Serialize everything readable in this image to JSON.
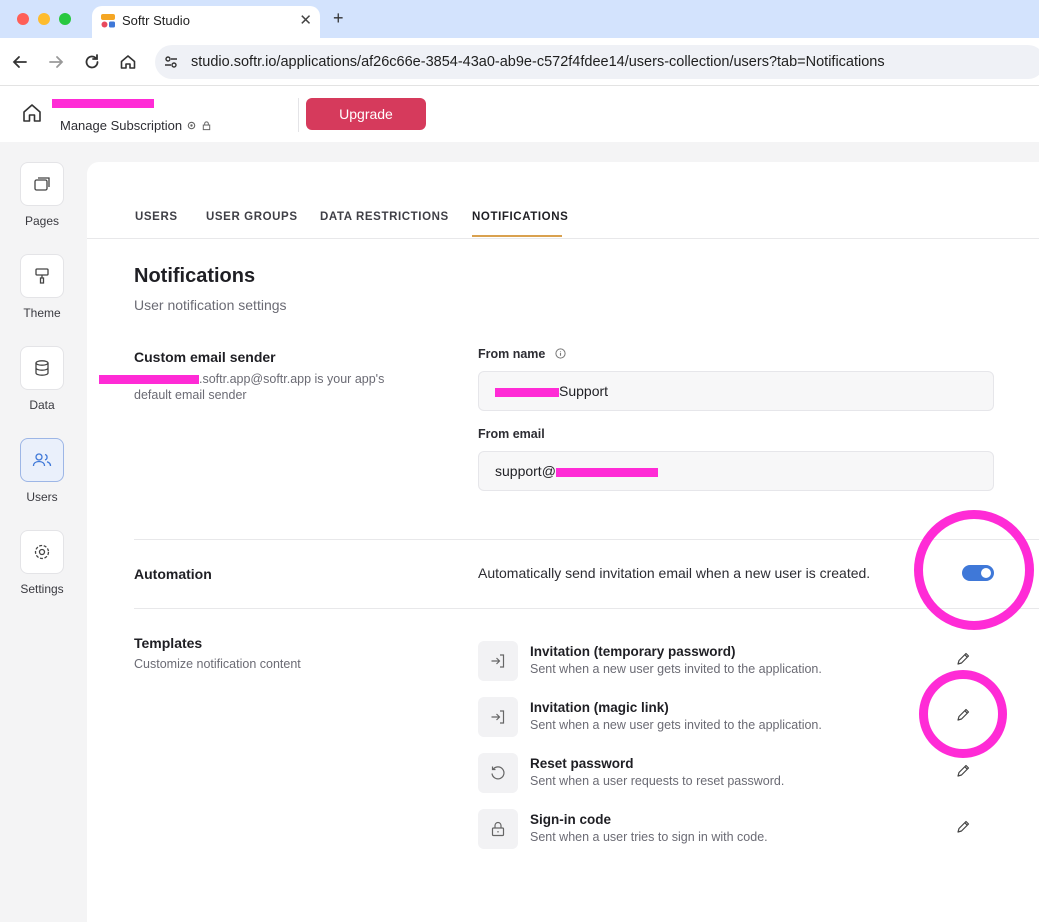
{
  "browser": {
    "tab_title": "Softr Studio",
    "new_tab": "+",
    "close": "✕",
    "url": "studio.softr.io/applications/af26c66e-3854-43a0-ab9e-c572f4fdee14/users-collection/users?tab=Notifications"
  },
  "header": {
    "manage_subscription": "Manage Subscription",
    "upgrade": "Upgrade"
  },
  "sidebar": {
    "items": [
      {
        "label": "Pages",
        "icon": "pages-icon"
      },
      {
        "label": "Theme",
        "icon": "paint-roller-icon"
      },
      {
        "label": "Data",
        "icon": "database-icon"
      },
      {
        "label": "Users",
        "icon": "users-icon",
        "active": true
      },
      {
        "label": "Settings",
        "icon": "gear-icon"
      }
    ]
  },
  "tabs": [
    "USERS",
    "USER GROUPS",
    "DATA RESTRICTIONS",
    "NOTIFICATIONS"
  ],
  "active_tab": "NOTIFICATIONS",
  "page": {
    "title": "Notifications",
    "subtitle": "User notification settings"
  },
  "sender": {
    "heading": "Custom email sender",
    "desc_line1": ".softr.app@softr.app is your app's",
    "desc_line2": "default email sender",
    "from_name_label": "From name",
    "from_name_value_suffix": "Support",
    "from_email_label": "From email",
    "from_email_value_prefix": "support@"
  },
  "automation": {
    "heading": "Automation",
    "text": "Automatically send invitation email when a new user is created.",
    "enabled": true
  },
  "templates": {
    "heading": "Templates",
    "subtitle": "Customize notification content",
    "items": [
      {
        "title": "Invitation (temporary password)",
        "desc": "Sent when a new user gets invited to the application.",
        "icon": "sign-in-icon"
      },
      {
        "title": "Invitation (magic link)",
        "desc": "Sent when a new user gets invited to the application.",
        "icon": "sign-in-icon"
      },
      {
        "title": "Reset password",
        "desc": "Sent when a user requests to reset password.",
        "icon": "reset-icon"
      },
      {
        "title": "Sign-in code",
        "desc": "Sent when a user tries to sign in with code.",
        "icon": "lock-icon"
      }
    ]
  },
  "colors": {
    "accent_underline": "#d9a14f",
    "upgrade_button": "#d63a5c",
    "toggle_on": "#3f78d8",
    "annotation": "#ff2bd6"
  }
}
